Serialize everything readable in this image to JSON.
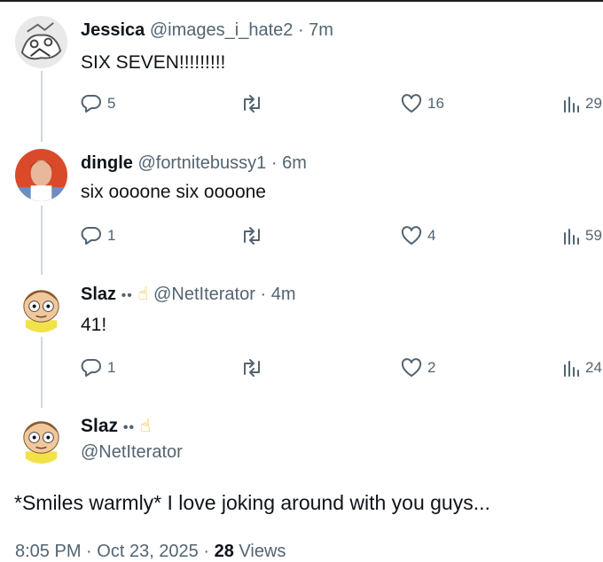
{
  "replies": [
    {
      "name": "Jessica",
      "handle": "@images_i_hate2",
      "time": "7m",
      "text": "SIX SEVEN!!!!!!!!!",
      "reply_count": "5",
      "like_count": "16",
      "view_count": "29"
    },
    {
      "name": "dingle",
      "handle": "@fortnitebussy1",
      "time": "6m",
      "text": "six oooone six oooone",
      "reply_count": "1",
      "like_count": "4",
      "view_count": "59"
    },
    {
      "name": "Slaz",
      "emoji": "••",
      "handle": "@NetIterator",
      "time": "4m",
      "text": "41!",
      "reply_count": "1",
      "like_count": "2",
      "view_count": "24"
    }
  ],
  "main_post": {
    "name": "Slaz",
    "emoji": "••",
    "handle": "@NetIterator",
    "text": "*Smiles warmly* I love joking around with you guys...",
    "time": "8:05 PM",
    "date": "Oct 23, 2025",
    "views_count": "28",
    "views_label": "Views"
  },
  "separator": "·",
  "icons": {
    "reply": "reply-icon",
    "retweet": "retweet-icon",
    "like": "heart-icon",
    "views": "views-icon",
    "hand": "pointing-hand-icon"
  },
  "colors": {
    "text": "#0f1419",
    "secondary": "#536471",
    "thread_line": "#cfd9de"
  }
}
